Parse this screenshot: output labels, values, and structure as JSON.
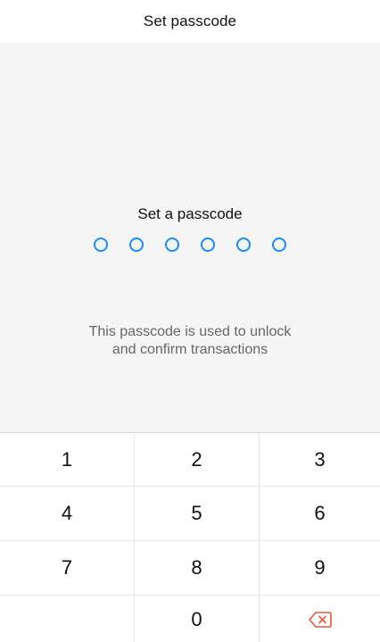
{
  "header": {
    "title": "Set passcode"
  },
  "entry": {
    "prompt": "Set a passcode",
    "digits_total": 6,
    "digits_entered": 0,
    "hint_line1": "This passcode is used to unlock",
    "hint_line2": "and confirm transactions"
  },
  "keypad": {
    "keys": [
      "1",
      "2",
      "3",
      "4",
      "5",
      "6",
      "7",
      "8",
      "9",
      "",
      "0",
      "delete"
    ],
    "delete_icon": "backspace-icon"
  },
  "colors": {
    "accent": "#1a8cff",
    "delete": "#e8573c",
    "panel_bg": "#f5f5f5",
    "text": "#111111",
    "hint": "#666666"
  }
}
